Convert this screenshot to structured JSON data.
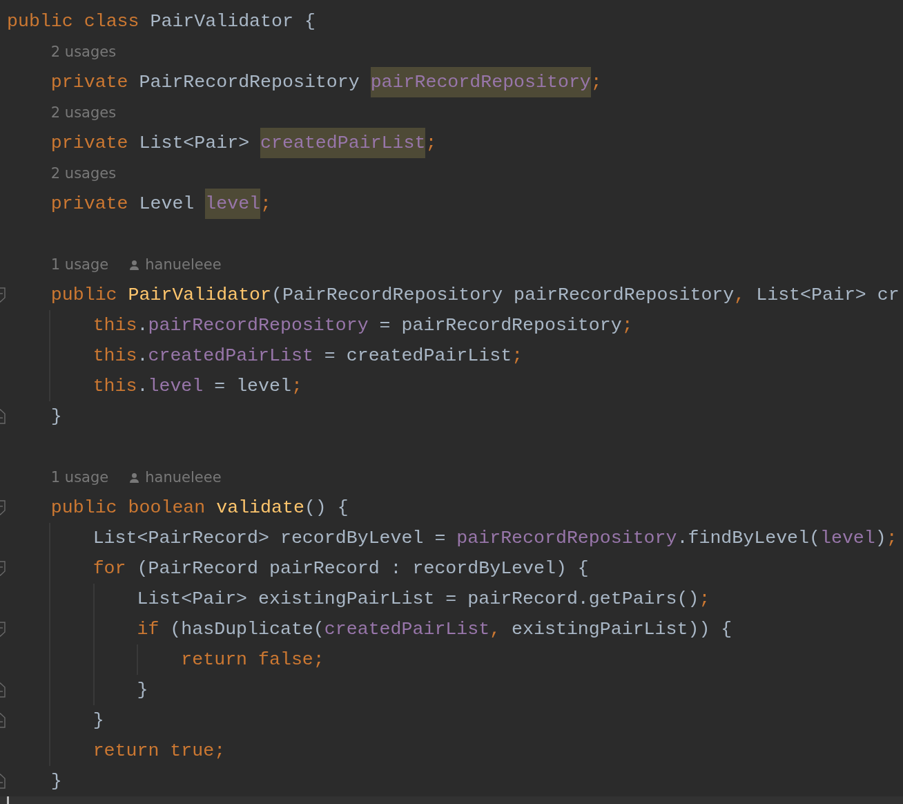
{
  "editor": {
    "lines": [
      {
        "kind": "code",
        "tokens": [
          {
            "text": "public class",
            "kind": "keyword"
          },
          {
            "text": " PairValidator {",
            "kind": "plain"
          }
        ],
        "children": [
          {
            "kind": "hint",
            "usages": "2 usages"
          },
          {
            "kind": "code",
            "tokens": [
              {
                "text": "private",
                "kind": "keyword"
              },
              {
                "text": " PairRecordRepository ",
                "kind": "plain"
              },
              {
                "text": "pairRecordRepository",
                "kind": "field",
                "highlight": true
              },
              {
                "text": ";",
                "kind": "keyword"
              }
            ]
          },
          {
            "kind": "hint",
            "usages": "2 usages"
          },
          {
            "kind": "code",
            "tokens": [
              {
                "text": "private",
                "kind": "keyword"
              },
              {
                "text": " List<Pair> ",
                "kind": "plain"
              },
              {
                "text": "createdPairList",
                "kind": "field",
                "highlight": true
              },
              {
                "text": ";",
                "kind": "keyword"
              }
            ]
          },
          {
            "kind": "hint",
            "usages": "2 usages"
          },
          {
            "kind": "code",
            "tokens": [
              {
                "text": "private",
                "kind": "keyword"
              },
              {
                "text": " Level ",
                "kind": "plain"
              },
              {
                "text": "level",
                "kind": "field",
                "highlight": true
              },
              {
                "text": ";",
                "kind": "keyword"
              }
            ]
          },
          {
            "kind": "blank"
          },
          {
            "kind": "hint",
            "usages": "1 usage",
            "author": "hanueleee"
          },
          {
            "kind": "code",
            "fold": {
              "kind": "start"
            },
            "tokens": [
              {
                "text": "public ",
                "kind": "keyword"
              },
              {
                "text": "PairValidator",
                "kind": "decl"
              },
              {
                "text": "(PairRecordRepository pairRecordRepository",
                "kind": "plain"
              },
              {
                "text": ",",
                "kind": "keyword"
              },
              {
                "text": " List<Pair> cr",
                "kind": "plain"
              }
            ],
            "children": [
              {
                "kind": "code",
                "tokens": [
                  {
                    "text": "this",
                    "kind": "keyword"
                  },
                  {
                    "text": ".",
                    "kind": "plain"
                  },
                  {
                    "text": "pairRecordRepository",
                    "kind": "field"
                  },
                  {
                    "text": " = pairRecordRepository",
                    "kind": "plain"
                  },
                  {
                    "text": ";",
                    "kind": "keyword"
                  }
                ]
              },
              {
                "kind": "code",
                "tokens": [
                  {
                    "text": "this",
                    "kind": "keyword"
                  },
                  {
                    "text": ".",
                    "kind": "plain"
                  },
                  {
                    "text": "createdPairList",
                    "kind": "field"
                  },
                  {
                    "text": " = createdPairList",
                    "kind": "plain"
                  },
                  {
                    "text": ";",
                    "kind": "keyword"
                  }
                ]
              },
              {
                "kind": "code",
                "tokens": [
                  {
                    "text": "this",
                    "kind": "keyword"
                  },
                  {
                    "text": ".",
                    "kind": "plain"
                  },
                  {
                    "text": "level",
                    "kind": "field"
                  },
                  {
                    "text": " = level",
                    "kind": "plain"
                  },
                  {
                    "text": ";",
                    "kind": "keyword"
                  }
                ]
              }
            ]
          },
          {
            "kind": "code",
            "fold": {
              "kind": "end"
            },
            "tokens": [
              {
                "text": "}",
                "kind": "plain"
              }
            ]
          },
          {
            "kind": "blank"
          },
          {
            "kind": "hint",
            "usages": "1 usage",
            "author": "hanueleee"
          },
          {
            "kind": "code",
            "fold": {
              "kind": "start"
            },
            "tokens": [
              {
                "text": "public boolean ",
                "kind": "keyword"
              },
              {
                "text": "validate",
                "kind": "decl"
              },
              {
                "text": "() {",
                "kind": "plain"
              }
            ],
            "children": [
              {
                "kind": "code",
                "tokens": [
                  {
                    "text": "List<PairRecord> recordByLevel = ",
                    "kind": "plain"
                  },
                  {
                    "text": "pairRecordRepository",
                    "kind": "field"
                  },
                  {
                    "text": ".findByLevel(",
                    "kind": "plain"
                  },
                  {
                    "text": "level",
                    "kind": "field"
                  },
                  {
                    "text": ")",
                    "kind": "plain"
                  },
                  {
                    "text": ";",
                    "kind": "keyword"
                  }
                ]
              },
              {
                "kind": "code",
                "fold": {
                  "kind": "start"
                },
                "tokens": [
                  {
                    "text": "for",
                    "kind": "keyword"
                  },
                  {
                    "text": " (PairRecord pairRecord : recordByLevel) {",
                    "kind": "plain"
                  }
                ],
                "children": [
                  {
                    "kind": "code",
                    "tokens": [
                      {
                        "text": "List<Pair> existingPairList = pairRecord.getPairs()",
                        "kind": "plain"
                      },
                      {
                        "text": ";",
                        "kind": "keyword"
                      }
                    ]
                  },
                  {
                    "kind": "code",
                    "fold": {
                      "kind": "start"
                    },
                    "tokens": [
                      {
                        "text": "if",
                        "kind": "keyword"
                      },
                      {
                        "text": " (hasDuplicate(",
                        "kind": "plain"
                      },
                      {
                        "text": "createdPairList",
                        "kind": "field"
                      },
                      {
                        "text": ",",
                        "kind": "keyword"
                      },
                      {
                        "text": " existingPairList)) {",
                        "kind": "plain"
                      }
                    ],
                    "children": [
                      {
                        "kind": "code",
                        "tokens": [
                          {
                            "text": "return false;",
                            "kind": "keyword"
                          }
                        ]
                      }
                    ]
                  },
                  {
                    "kind": "code",
                    "fold": {
                      "kind": "end"
                    },
                    "tokens": [
                      {
                        "text": "}",
                        "kind": "plain"
                      }
                    ]
                  }
                ]
              },
              {
                "kind": "code",
                "fold": {
                  "kind": "end"
                },
                "tokens": [
                  {
                    "text": "}",
                    "kind": "plain"
                  }
                ]
              },
              {
                "kind": "code",
                "tokens": [
                  {
                    "text": "return true;",
                    "kind": "keyword"
                  }
                ]
              }
            ]
          },
          {
            "kind": "code",
            "fold": {
              "kind": "end"
            },
            "tokens": [
              {
                "text": "}",
                "kind": "plain"
              }
            ]
          }
        ]
      }
    ]
  }
}
